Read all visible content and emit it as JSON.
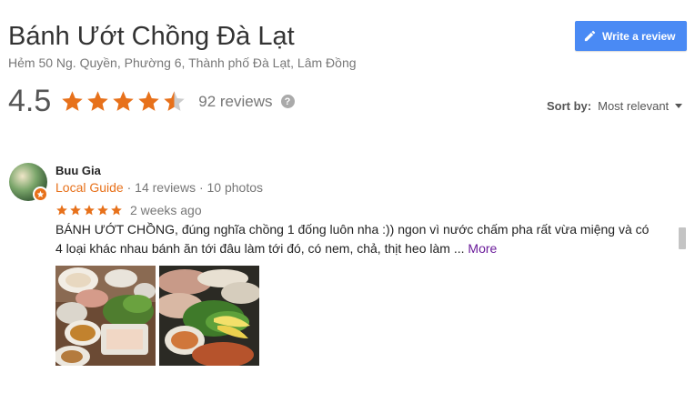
{
  "place": {
    "title": "Bánh Ướt Chồng Đà Lạt",
    "address": "Hẻm 50 Ng. Quyền, Phường 6, Thành phố Đà Lạt, Lâm Đồng"
  },
  "write_review": {
    "label": "Write a review",
    "icon": "pencil-icon"
  },
  "summary": {
    "rating": "4.5",
    "rating_value": 4.5,
    "stars_max": 5,
    "review_count": "92 reviews",
    "info_icon": "?"
  },
  "sort": {
    "label": "Sort by:",
    "value": "Most relevant"
  },
  "reviews": [
    {
      "author": "Buu Gia",
      "badge": "Local Guide",
      "reviews_count": "· 14 reviews",
      "photos_count": "· 10 photos",
      "stars": 5,
      "time": "2 weeks ago",
      "text": "BÁNH ƯỚT CHỒNG, đúng nghĩa chồng 1 đống luôn nha :)) ngon vì nước chấm pha rất vừa miệng và có 4 loại khác nhau bánh ăn tới đâu làm tới đó, có nem, chả, thịt heo làm ...",
      "more": "More",
      "photos": [
        "food-photo-1",
        "food-photo-2"
      ]
    }
  ],
  "colors": {
    "accent_blue": "#4a8af4",
    "star_orange": "#e7711b",
    "more_purple": "#6a1b9a"
  }
}
